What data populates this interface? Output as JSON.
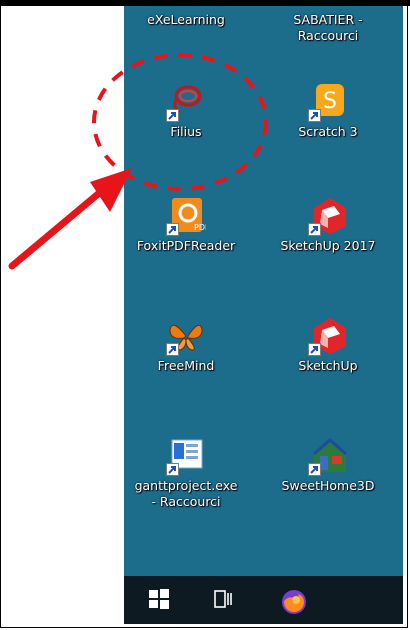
{
  "desktop": {
    "icons": [
      {
        "label": "eXeLearning",
        "icon": "exelearning-icon"
      },
      {
        "label": "SABATIER -\nRaccourci",
        "icon": "shortcut-icon"
      },
      {
        "label": "Filius",
        "icon": "filius-icon"
      },
      {
        "label": "Scratch 3",
        "icon": "scratch-icon"
      },
      {
        "label": "FoxitPDFReader",
        "icon": "foxit-pdf-icon"
      },
      {
        "label": "SketchUp 2017",
        "icon": "sketchup-icon"
      },
      {
        "label": "FreeMind",
        "icon": "freemind-butterfly-icon"
      },
      {
        "label": "SketchUp",
        "icon": "sketchup-icon"
      },
      {
        "label": "ganttproject.exe\n- Raccourci",
        "icon": "ganttproject-icon"
      },
      {
        "label": "SweetHome3D",
        "icon": "sweethome3d-icon"
      }
    ]
  },
  "taskbar": {
    "items": [
      {
        "icon": "windows-start-icon"
      },
      {
        "icon": "task-view-icon"
      },
      {
        "icon": "firefox-icon"
      }
    ]
  },
  "annotation": {
    "circle_color": "#e8141a",
    "arrow_color": "#e8141a"
  }
}
